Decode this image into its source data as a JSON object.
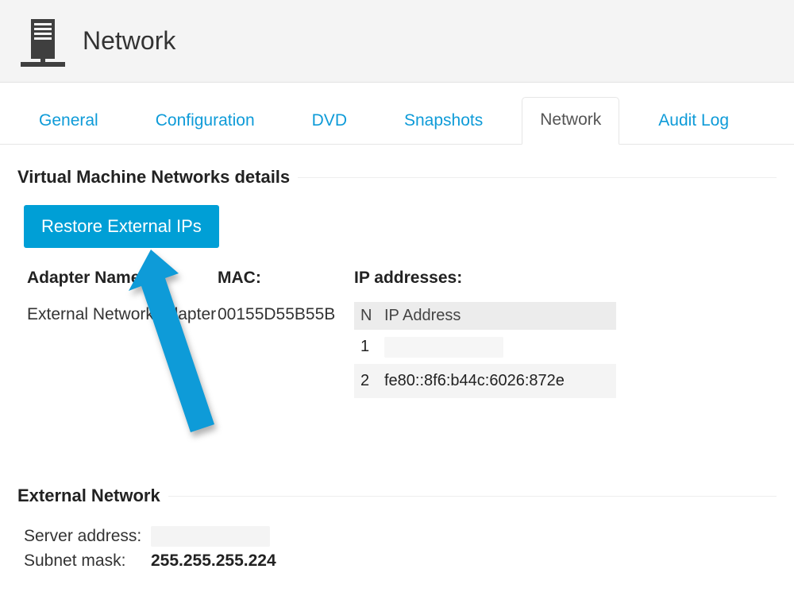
{
  "header": {
    "title": "Network"
  },
  "tabs": {
    "items": [
      {
        "label": "General"
      },
      {
        "label": "Configuration"
      },
      {
        "label": "DVD"
      },
      {
        "label": "Snapshots"
      },
      {
        "label": "Network"
      },
      {
        "label": "Audit Log"
      }
    ],
    "active_index": 4
  },
  "sections": {
    "vm_details": {
      "heading": "Virtual Machine Networks details",
      "restore_button_label": "Restore External IPs",
      "columns": {
        "adapter_label": "Adapter Name:",
        "mac_label": "MAC:",
        "ip_label": "IP addresses:"
      },
      "adapter_name": "External Network Adapter",
      "mac": "00155D55B55B",
      "ip_table": {
        "head_n": "N",
        "head_addr": "IP Address",
        "rows": [
          {
            "n": "1",
            "addr": ""
          },
          {
            "n": "2",
            "addr": "fe80::8f6:b44c:6026:872e"
          }
        ]
      }
    },
    "external_network": {
      "heading": "External Network",
      "server_address_label": "Server address:",
      "server_address_value": "",
      "subnet_mask_label": "Subnet mask:",
      "subnet_mask_value": "255.255.255.224"
    }
  },
  "colors": {
    "accent": "#009fd6",
    "link": "#0e9bd8"
  }
}
